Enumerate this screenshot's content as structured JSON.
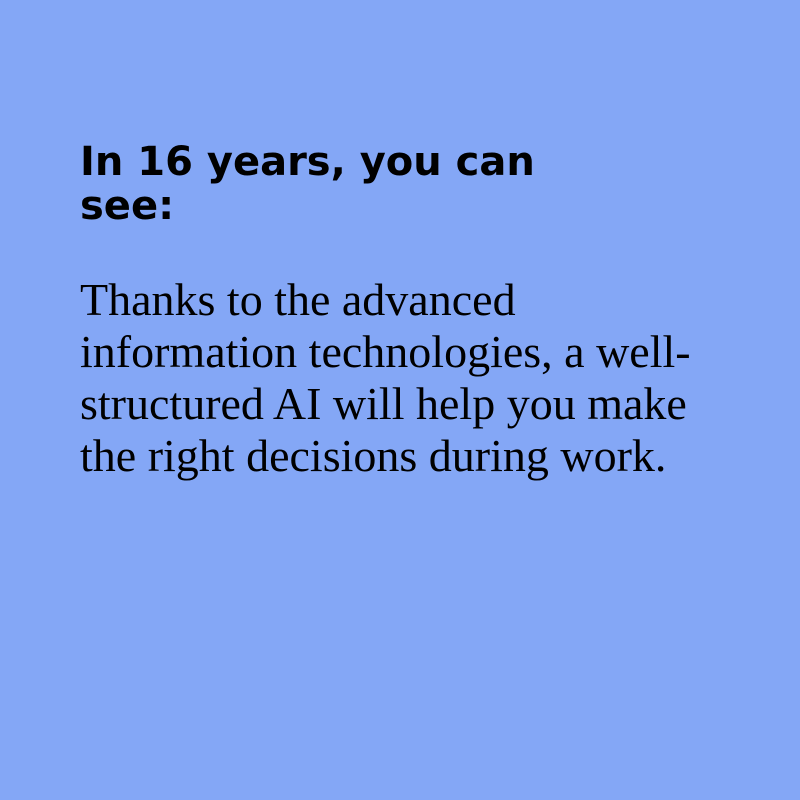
{
  "heading": "In 16 years, you can see:",
  "body": "Thanks to the advanced information technologies, a well-structured AI will help you make the right decisions during work.",
  "colors": {
    "background": "#84a7f6",
    "text": "#000000"
  }
}
